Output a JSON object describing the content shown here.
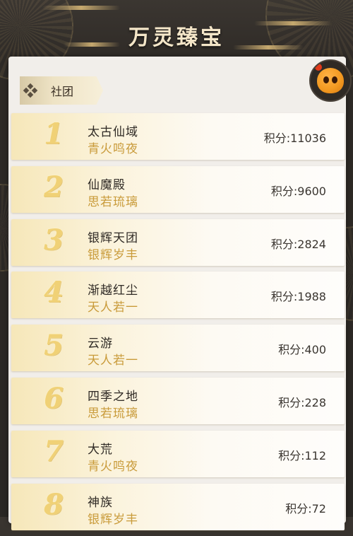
{
  "header": {
    "title": "万灵臻宝"
  },
  "tab": {
    "label": "社团"
  },
  "avatar": {
    "icon": "orange-pet-icon"
  },
  "rows": [
    {
      "rank": "1",
      "name": "太古仙域",
      "sub": "青火鸣夜",
      "score": "积分:11036"
    },
    {
      "rank": "2",
      "name": "仙魔殿",
      "sub": "思若琉璃",
      "score": "积分:9600"
    },
    {
      "rank": "3",
      "name": "银辉天团",
      "sub": "银辉岁丰",
      "score": "积分:2824"
    },
    {
      "rank": "4",
      "name": "渐越红尘",
      "sub": "天人若一",
      "score": "积分:1988"
    },
    {
      "rank": "5",
      "name": "云游",
      "sub": "天人若一",
      "score": "积分:400"
    },
    {
      "rank": "6",
      "name": "四季之地",
      "sub": "思若琉璃",
      "score": "积分:228"
    },
    {
      "rank": "7",
      "name": "大荒",
      "sub": "青火鸣夜",
      "score": "积分:112"
    },
    {
      "rank": "8",
      "name": "神族",
      "sub": "银辉岁丰",
      "score": "积分:72"
    }
  ],
  "colors": {
    "accent": "#c99b3a",
    "rank_gold": "#f0d176",
    "panel_bg": "#f1eeea"
  }
}
